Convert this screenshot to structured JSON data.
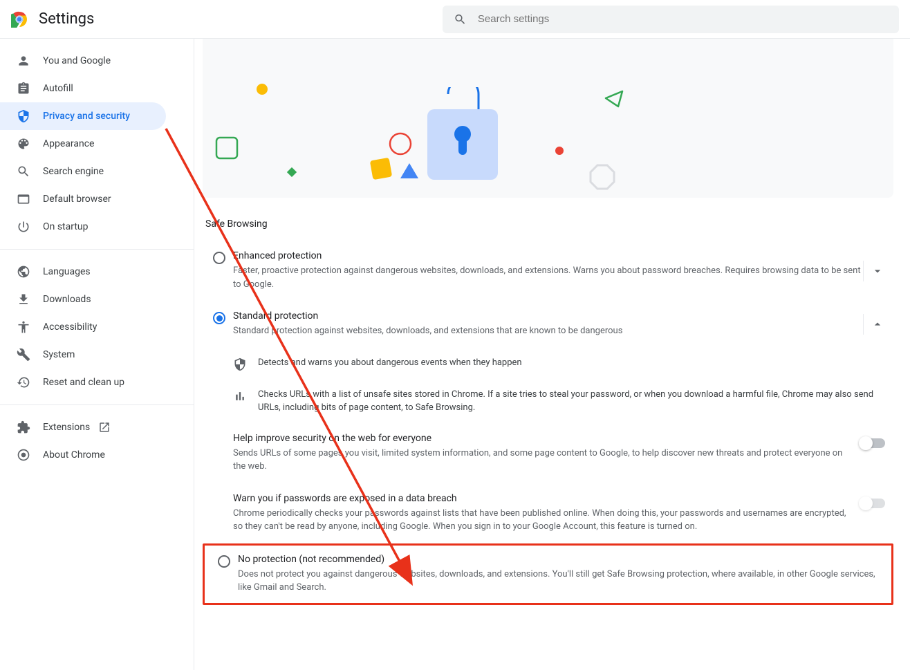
{
  "header": {
    "title": "Settings",
    "search_placeholder": "Search settings"
  },
  "sidebar": {
    "items1": [
      {
        "label": "You and Google"
      },
      {
        "label": "Autofill"
      },
      {
        "label": "Privacy and security"
      },
      {
        "label": "Appearance"
      },
      {
        "label": "Search engine"
      },
      {
        "label": "Default browser"
      },
      {
        "label": "On startup"
      }
    ],
    "items2": [
      {
        "label": "Languages"
      },
      {
        "label": "Downloads"
      },
      {
        "label": "Accessibility"
      },
      {
        "label": "System"
      },
      {
        "label": "Reset and clean up"
      }
    ],
    "items3": [
      {
        "label": "Extensions"
      },
      {
        "label": "About Chrome"
      }
    ]
  },
  "main": {
    "section_title": "Safe Browsing",
    "options": [
      {
        "title": "Enhanced protection",
        "desc": "Faster, proactive protection against dangerous websites, downloads, and extensions. Warns you about password breaches. Requires browsing data to be sent to Google."
      },
      {
        "title": "Standard protection",
        "desc": "Standard protection against websites, downloads, and extensions that are known to be dangerous"
      },
      {
        "title": "No protection (not recommended)",
        "desc": "Does not protect you against dangerous websites, downloads, and extensions. You'll still get Safe Browsing protection, where available, in other Google services, like Gmail and Search."
      }
    ],
    "details": [
      "Detects and warns you about dangerous events when they happen",
      "Checks URLs with a list of unsafe sites stored in Chrome. If a site tries to steal your password, or when you download a harmful file, Chrome may also send URLs, including bits of page content, to Safe Browsing."
    ],
    "toggles": [
      {
        "title": "Help improve security on the web for everyone",
        "desc": "Sends URLs of some pages you visit, limited system information, and some page content to Google, to help discover new threats and protect everyone on the web."
      },
      {
        "title": "Warn you if passwords are exposed in a data breach",
        "desc": "Chrome periodically checks your passwords against lists that have been published online. When doing this, your passwords and usernames are encrypted, so they can't be read by anyone, including Google. When you sign in to your Google Account, this feature is turned on."
      }
    ]
  }
}
